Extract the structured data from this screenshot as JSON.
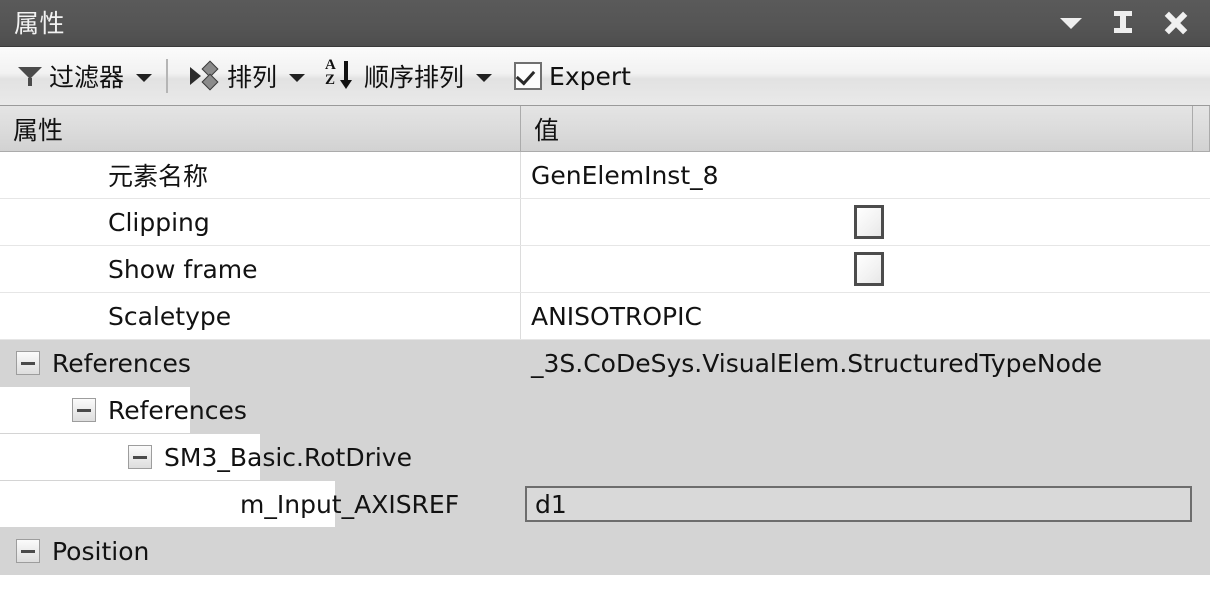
{
  "window": {
    "title": "属性",
    "buttons": [
      {
        "name": "menu-dropdown",
        "icon": "caret-down-icon"
      },
      {
        "name": "auto-hide-pin",
        "icon": "pin-icon"
      },
      {
        "name": "close",
        "icon": "close-icon"
      }
    ]
  },
  "toolbar": {
    "filter_label": "过滤器",
    "filter_icon": "funnel-icon",
    "arrange_label": "排列",
    "arrange_icon": "arrange-icon",
    "sort_label": "顺序排列",
    "sort_icon": "sort-az-icon",
    "expert_label": "Expert",
    "expert_checked": true
  },
  "grid": {
    "columns": [
      "属性",
      "值"
    ],
    "rows": [
      {
        "name": "元素名称",
        "value": "GenElemInst_8",
        "value_type": "text",
        "depth": 1,
        "expander": "none",
        "shade": "white"
      },
      {
        "name": "Clipping",
        "value": "",
        "value_type": "checkbox",
        "checked": false,
        "depth": 1,
        "expander": "none",
        "shade": "white"
      },
      {
        "name": "Show frame",
        "value": "",
        "value_type": "checkbox",
        "checked": false,
        "depth": 1,
        "expander": "none",
        "shade": "white"
      },
      {
        "name": "Scaletype",
        "value": "ANISOTROPIC",
        "value_type": "text",
        "depth": 1,
        "expander": "none",
        "shade": "white"
      },
      {
        "name": "References",
        "value": "_3S.CoDeSys.VisualElem.StructuredTypeNode",
        "value_type": "text",
        "depth": 0,
        "expander": "minus",
        "shade": "gray"
      },
      {
        "name": "References",
        "value": "",
        "value_type": "none",
        "depth": 1,
        "expander": "minus",
        "shade": "gray"
      },
      {
        "name": "SM3_Basic.RotDrive",
        "value": "",
        "value_type": "none",
        "depth": 2,
        "expander": "minus",
        "shade": "gray"
      },
      {
        "name": "m_Input_AXISREF",
        "value": "d1",
        "value_type": "edit",
        "depth": 3,
        "expander": "none",
        "shade": "gray"
      },
      {
        "name": "Position",
        "value": "",
        "value_type": "none",
        "depth": 0,
        "expander": "minus",
        "shade": "gray"
      }
    ]
  },
  "colors": {
    "titlebar": "#555555",
    "toolbar": "#eeeeee",
    "header": "#dcdcdc",
    "row_gray": "#d4d4d4",
    "row_white": "#ffffff",
    "text": "#121212"
  }
}
